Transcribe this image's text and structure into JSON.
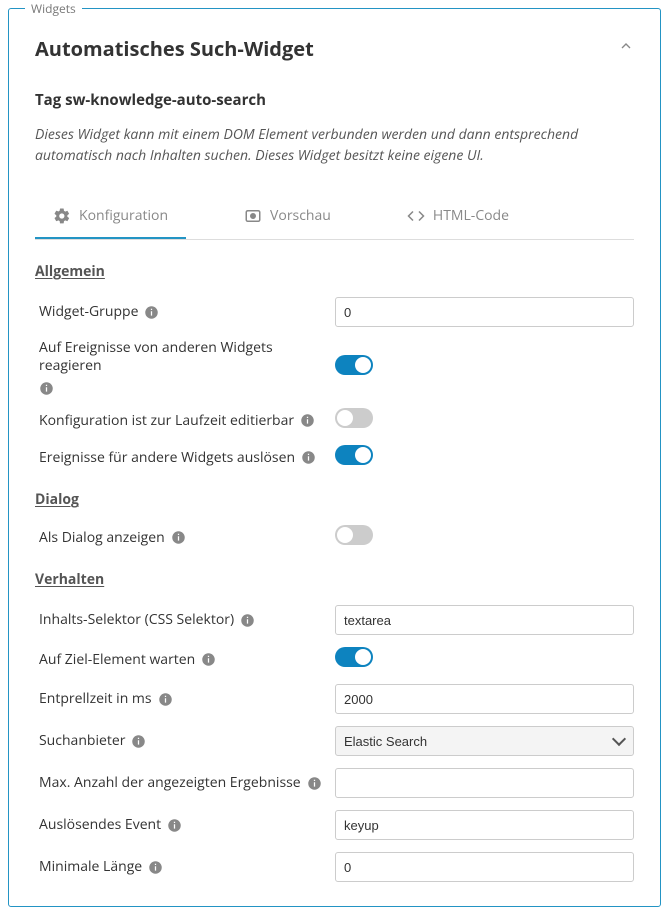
{
  "fieldset_label": "Widgets",
  "header": {
    "title": "Automatisches Such-Widget"
  },
  "tag_prefix": "Tag",
  "tag_value": "sw-knowledge-auto-search",
  "description": "Dieses Widget kann mit einem DOM Element verbunden werden und dann entsprechend automatisch nach Inhalten suchen. Dieses Widget besitzt keine eigene UI.",
  "tabs": {
    "config": "Konfiguration",
    "preview": "Vorschau",
    "html": "HTML-Code"
  },
  "sections": {
    "general": "Allgemein",
    "dialog": "Dialog",
    "behavior": "Verhalten"
  },
  "fields": {
    "widget_group": {
      "label": "Widget-Gruppe",
      "value": "0"
    },
    "react_events": {
      "label": "Auf Ereignisse von anderen Widgets reagieren",
      "value": true
    },
    "runtime_editable": {
      "label": "Konfiguration ist zur Laufzeit editierbar",
      "value": false
    },
    "trigger_events": {
      "label": "Ereignisse für andere Widgets auslösen",
      "value": true
    },
    "as_dialog": {
      "label": "Als Dialog anzeigen",
      "value": false
    },
    "content_selector": {
      "label": "Inhalts-Selektor (CSS Selektor)",
      "value": "textarea"
    },
    "wait_target": {
      "label": "Auf Ziel-Element warten",
      "value": true
    },
    "debounce": {
      "label": "Entprellzeit in ms",
      "value": "2000"
    },
    "search_provider": {
      "label": "Suchanbieter",
      "value": "Elastic Search"
    },
    "max_results": {
      "label": "Max. Anzahl der angezeigten Ergebnisse",
      "value": ""
    },
    "trigger_event": {
      "label": "Auslösendes Event",
      "value": "keyup"
    },
    "min_length": {
      "label": "Minimale Länge",
      "value": "0"
    }
  }
}
